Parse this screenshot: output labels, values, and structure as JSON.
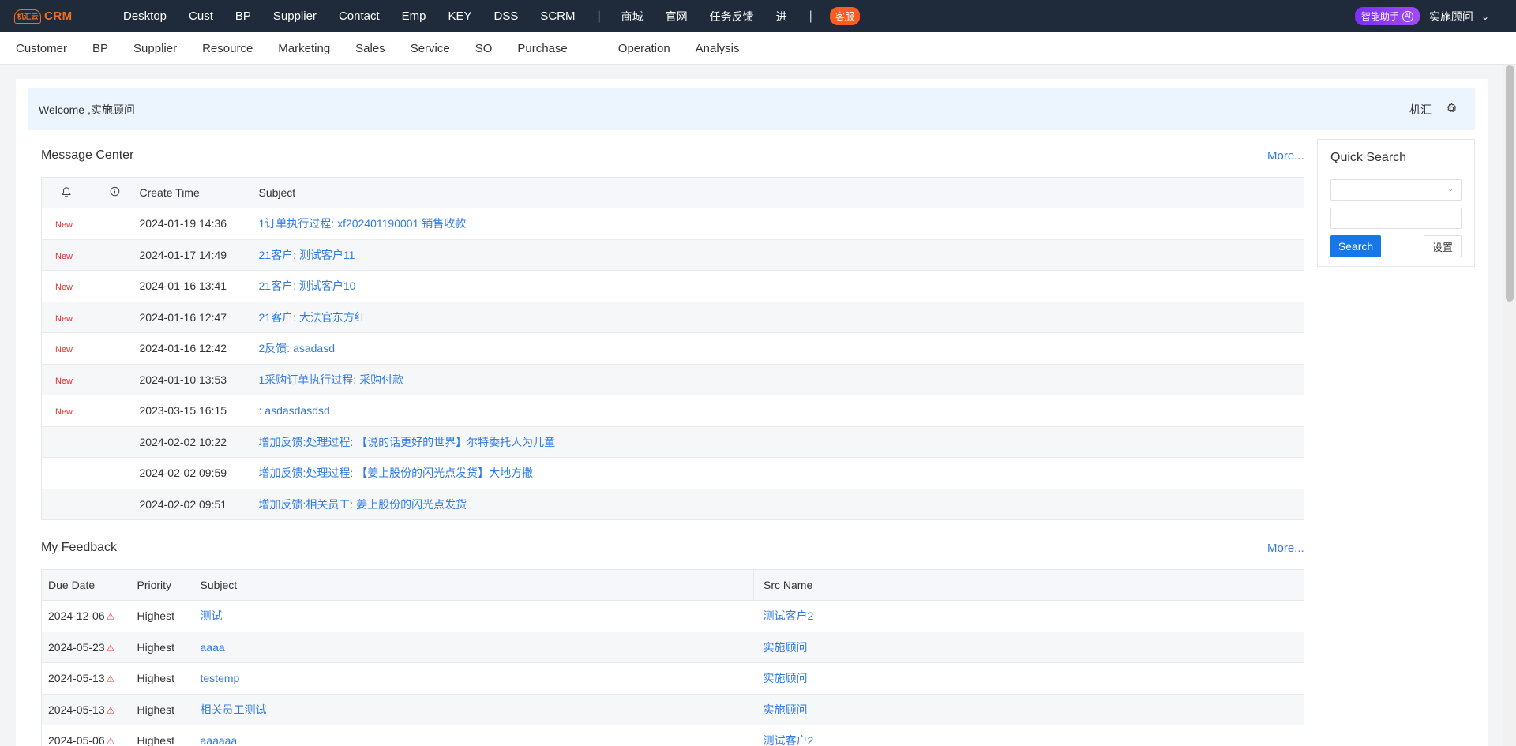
{
  "topbar": {
    "logo_mark": "机汇云",
    "logo_text": "CRM",
    "nav": [
      "Desktop",
      "Cust",
      "BP",
      "Supplier",
      "Contact",
      "Emp",
      "KEY",
      "DSS",
      "SCRM"
    ],
    "nav_cn": [
      "商城",
      "官网",
      "任务反馈",
      "进"
    ],
    "kefu": "客服",
    "ai_assistant": "智能助手",
    "ai_dot": "AI",
    "user": "实施顾问"
  },
  "subnav": [
    "Customer",
    "BP",
    "Supplier",
    "Resource",
    "Marketing",
    "Sales",
    "Service",
    "SO",
    "Purchase",
    "Operation",
    "Analysis"
  ],
  "welcome": {
    "text": "Welcome ,实施顾问",
    "company": "机汇"
  },
  "message_center": {
    "title": "Message Center",
    "more": "More...",
    "headers": [
      "",
      "",
      "Create Time",
      "Subject"
    ],
    "rows": [
      {
        "tag": "New",
        "time": "2024-01-19 14:36",
        "subject": "1订单执行过程: xf202401190001 销售收款"
      },
      {
        "tag": "New",
        "time": "2024-01-17 14:49",
        "subject": "21客户: 测试客户11"
      },
      {
        "tag": "New",
        "time": "2024-01-16 13:41",
        "subject": "21客户: 测试客户10"
      },
      {
        "tag": "New",
        "time": "2024-01-16 12:47",
        "subject": "21客户: 大法官东方红"
      },
      {
        "tag": "New",
        "time": "2024-01-16 12:42",
        "subject": "2反馈: asadasd"
      },
      {
        "tag": "New",
        "time": "2024-01-10 13:53",
        "subject": "1采购订单执行过程: 采购付款"
      },
      {
        "tag": "New",
        "time": "2023-03-15 16:15",
        "subject": ": asdasdasdsd"
      },
      {
        "tag": "",
        "time": "2024-02-02 10:22",
        "subject": "增加反馈:处理过程: 【说的话更好的世界】尔特委托人为儿童"
      },
      {
        "tag": "",
        "time": "2024-02-02 09:59",
        "subject": "增加反馈:处理过程: 【姜上股份的闪光点发货】大地方撒"
      },
      {
        "tag": "",
        "time": "2024-02-02 09:51",
        "subject": "增加反馈:相关员工: 姜上股份的闪光点发货"
      }
    ]
  },
  "my_feedback": {
    "title": "My Feedback",
    "more": "More...",
    "headers": [
      "Due Date",
      "Priority",
      "Subject",
      "Src Name"
    ],
    "rows": [
      {
        "due": "2024-12-06",
        "priority": "Highest",
        "subject": "测试",
        "src": "测试客户2"
      },
      {
        "due": "2024-05-23",
        "priority": "Highest",
        "subject": "aaaa",
        "src": "实施顾问"
      },
      {
        "due": "2024-05-13",
        "priority": "Highest",
        "subject": "testemp",
        "src": "实施顾问"
      },
      {
        "due": "2024-05-13",
        "priority": "Highest",
        "subject": "相关员工测试",
        "src": "实施顾问"
      },
      {
        "due": "2024-05-06",
        "priority": "Highest",
        "subject": "aaaaaa",
        "src": "测试客户2"
      }
    ]
  },
  "quick_search": {
    "title": "Quick Search",
    "select_value": "",
    "input_value": "",
    "search_label": "Search",
    "setting_label": "设置"
  },
  "colors": {
    "topbar": "#1f2a3a",
    "accent": "#2f7ae5",
    "brand": "#f26d21",
    "new_tag": "#e5302f"
  }
}
